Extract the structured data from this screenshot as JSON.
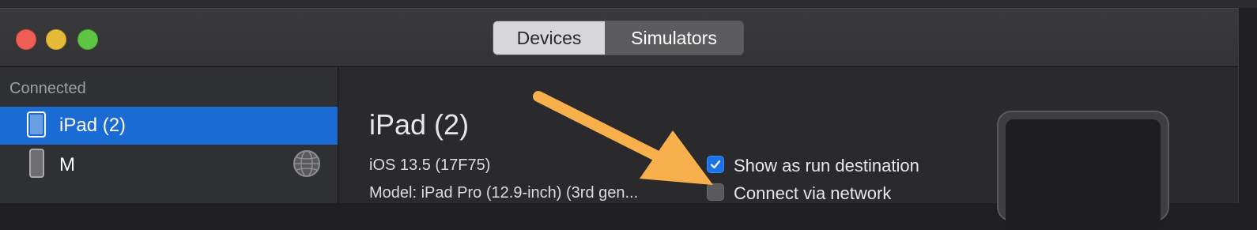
{
  "toolbar": {
    "tabs": [
      {
        "label": "Devices",
        "selected": true
      },
      {
        "label": "Simulators",
        "selected": false
      }
    ]
  },
  "sidebar": {
    "section_header": "Connected",
    "items": [
      {
        "label": "iPad (2)",
        "icon": "ipad-icon",
        "selected": true
      },
      {
        "label": "M",
        "icon": "iphone-icon",
        "selected": false,
        "accessory_icon": "network-globe-icon"
      }
    ]
  },
  "detail": {
    "title": "iPad (2)",
    "ios_version": "iOS 13.5 (17F75)",
    "model": "Model: iPad Pro (12.9-inch) (3rd gen...",
    "options": [
      {
        "label": "Show as run destination",
        "checked": true
      },
      {
        "label": "Connect via network",
        "checked": false
      }
    ]
  },
  "annotation": {
    "type": "arrow",
    "color": "#f7b04c",
    "points_to": "Connect via network"
  },
  "colors": {
    "accent": "#1a6bd3",
    "checkbox_checked": "#1a73e8",
    "arrow": "#f7b04c"
  }
}
